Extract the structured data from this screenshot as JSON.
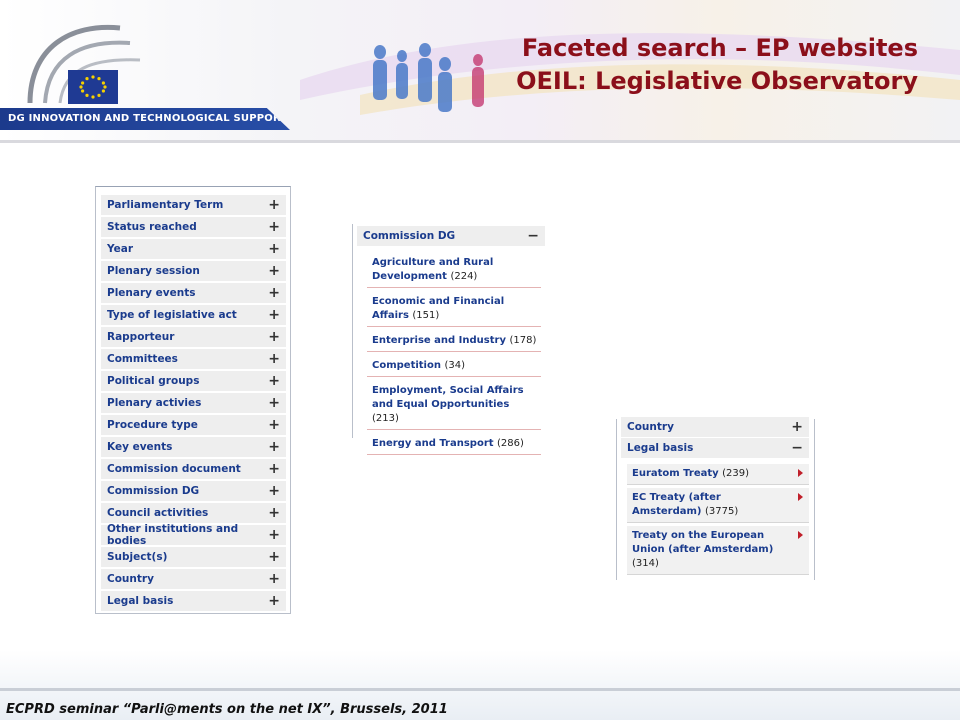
{
  "header": {
    "dg_label": "DG INNOVATION AND TECHNOLOGICAL SUPPORT",
    "title_line1": "Faceted search – EP websites",
    "title_line2": "OEIL: Legislative Observatory"
  },
  "facets": [
    "Parliamentary Term",
    "Status reached",
    "Year",
    "Plenary session",
    "Plenary events",
    "Type of legislative act",
    "Rapporteur",
    "Committees",
    "Political groups",
    "Plenary activies",
    "Procedure type",
    "Key events",
    "Commission document",
    "Commission DG",
    "Council activities",
    "Other institutions and bodies",
    "Subject(s)",
    "Country",
    "Legal basis"
  ],
  "commission_dg": {
    "header": "Commission DG",
    "items": [
      {
        "label": "Agriculture and Rural Development",
        "count": "(224)"
      },
      {
        "label": "Economic and Financial Affairs",
        "count": "(151)"
      },
      {
        "label": "Enterprise and Industry",
        "count": "(178)"
      },
      {
        "label": "Competition",
        "count": "(34)"
      },
      {
        "label": "Employment, Social Affairs and Equal Opportunities",
        "count": "(213)"
      },
      {
        "label": "Energy and Transport",
        "count": "(286)"
      }
    ]
  },
  "legal_basis": {
    "country_label": "Country",
    "header": "Legal basis",
    "items": [
      {
        "label": "Euratom Treaty",
        "count": "(239)"
      },
      {
        "label": "EC Treaty (after Amsterdam)",
        "count": "(3775)"
      },
      {
        "label": "Treaty on the European Union (after Amsterdam)",
        "count": "(314)"
      }
    ]
  },
  "footer": {
    "text": "ECPRD seminar “Parli@ments on the net IX”, Brussels, 2011"
  },
  "icons": {
    "expand": "+",
    "collapse": "−"
  },
  "colors": {
    "title": "#8b0f1a",
    "link": "#1a3b8d",
    "dg_bar": "#1c3a8c",
    "arrow": "#c0202b"
  }
}
